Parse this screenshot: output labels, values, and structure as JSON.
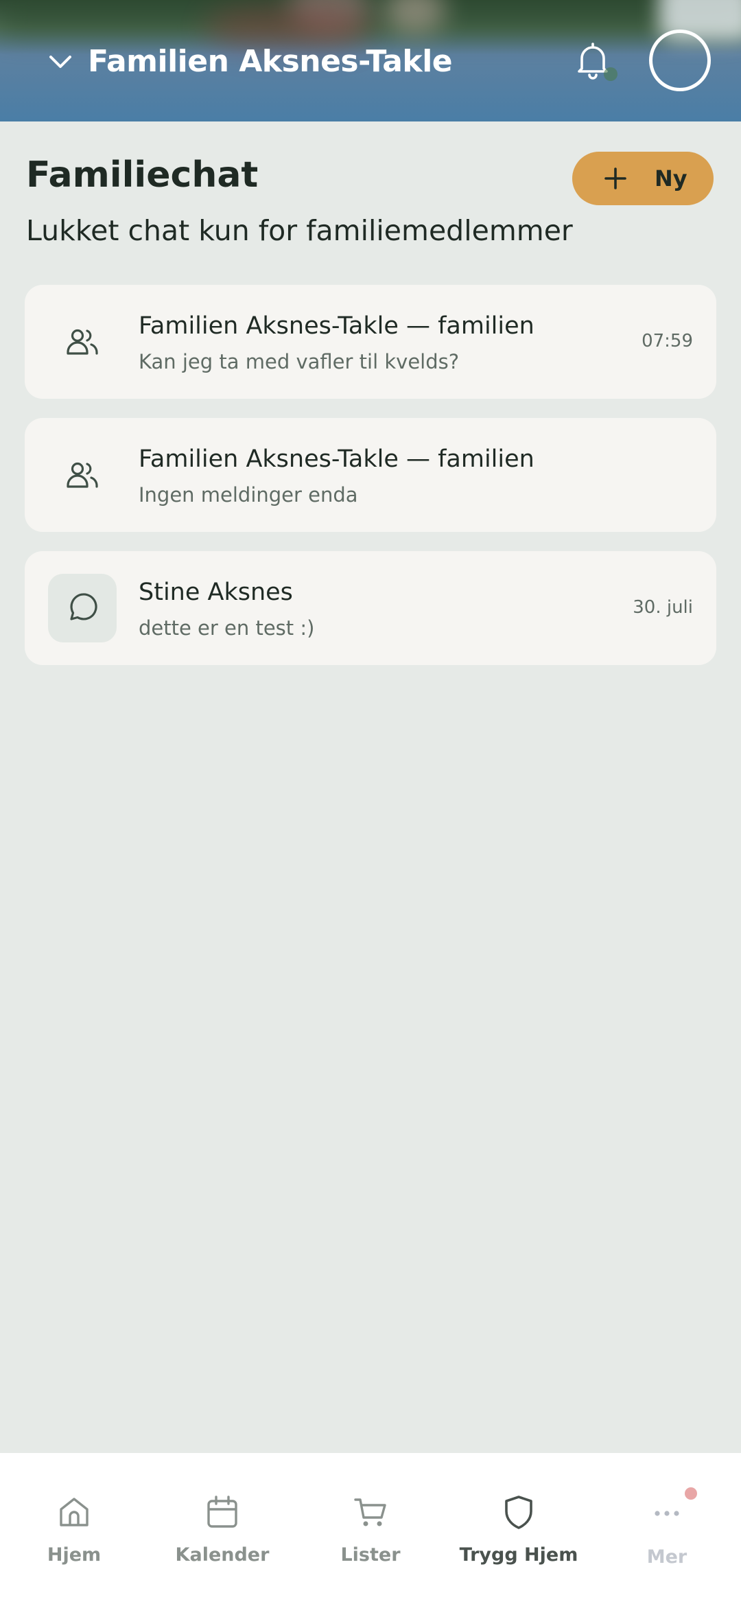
{
  "header": {
    "family_name": "Familien Aksnes-Takle",
    "icons": [
      "chevron-down-icon",
      "bell-icon",
      "avatar"
    ]
  },
  "page": {
    "title": "Familiechat",
    "subtitle": "Lukket chat kun for familiemedlemmer",
    "new_button_label": "Ny",
    "accent_color": "#d9a050"
  },
  "chats": [
    {
      "title": "Familien Aksnes-Takle — familien",
      "subtitle": "Kan jeg ta med vafler til kvelds?",
      "time": "07:59",
      "icon": "group-icon"
    },
    {
      "title": "Familien Aksnes-Takle — familien",
      "subtitle": "Ingen meldinger enda",
      "time": "",
      "icon": "group-icon"
    },
    {
      "title": "Stine Aksnes",
      "subtitle": "dette er en test :)",
      "time": "30. juli",
      "icon": "chat-bubble-icon"
    }
  ],
  "nav": {
    "items": [
      {
        "label": "Hjem",
        "icon": "home-icon"
      },
      {
        "label": "Kalender",
        "icon": "calendar-icon"
      },
      {
        "label": "Lister",
        "icon": "cart-icon"
      },
      {
        "label": "Trygg Hjem",
        "icon": "shield-icon",
        "active": true
      },
      {
        "label": "Mer",
        "icon": "more-icon"
      }
    ]
  }
}
